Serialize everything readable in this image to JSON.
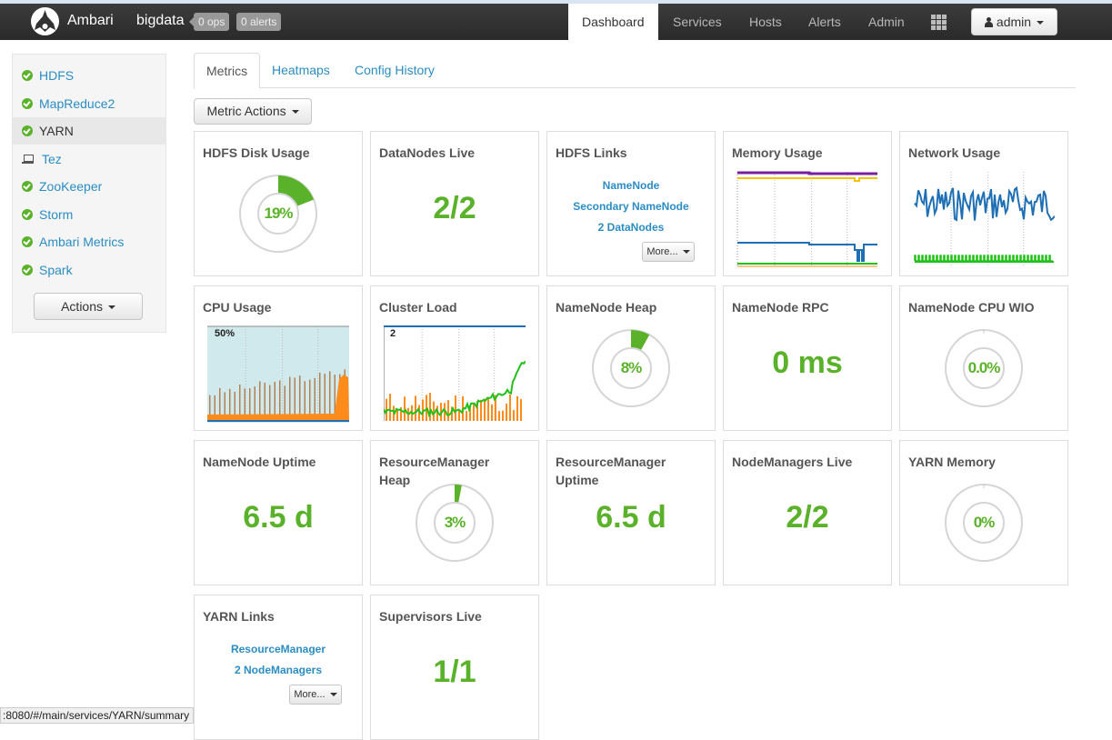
{
  "header": {
    "brand": "Ambari",
    "cluster_name": "bigdata",
    "ops_badge": "0 ops",
    "alerts_badge": "0 alerts",
    "nav": [
      {
        "label": "Dashboard",
        "active": true
      },
      {
        "label": "Services",
        "active": false
      },
      {
        "label": "Hosts",
        "active": false
      },
      {
        "label": "Alerts",
        "active": false
      },
      {
        "label": "Admin",
        "active": false
      }
    ],
    "views_icon": "grid-icon",
    "user_menu": "admin"
  },
  "sidebar": {
    "services": [
      {
        "label": "HDFS",
        "status": "ok"
      },
      {
        "label": "MapReduce2",
        "status": "ok"
      },
      {
        "label": "YARN",
        "status": "ok",
        "active": true
      },
      {
        "label": "Tez",
        "status": "client-only"
      },
      {
        "label": "ZooKeeper",
        "status": "ok"
      },
      {
        "label": "Storm",
        "status": "ok"
      },
      {
        "label": "Ambari Metrics",
        "status": "ok"
      },
      {
        "label": "Spark",
        "status": "ok"
      }
    ],
    "actions_label": "Actions"
  },
  "tabs": [
    {
      "label": "Metrics",
      "active": true
    },
    {
      "label": "Heatmaps",
      "active": false
    },
    {
      "label": "Config History",
      "active": false
    }
  ],
  "metric_actions_label": "Metric Actions",
  "colors": {
    "ok_green": "#5ab22a",
    "link_blue": "#2b8dc3",
    "chart_blue": "#1f6fb4",
    "chart_orange": "#ff8c1a",
    "chart_purple": "#7a1fa2",
    "chart_yellow": "#f5c400",
    "chart_green": "#22c01a",
    "cpu_bg": "#cfe9ec"
  },
  "widgets": {
    "hdfs_disk_usage": {
      "title": "HDFS Disk Usage",
      "value": "19%",
      "fraction": 0.19
    },
    "datanodes_live": {
      "title": "DataNodes Live",
      "value": "2/2"
    },
    "hdfs_links": {
      "title": "HDFS Links",
      "links": [
        "NameNode",
        "Secondary NameNode",
        "2 DataNodes"
      ],
      "more": "More..."
    },
    "memory_usage": {
      "title": "Memory Usage"
    },
    "network_usage": {
      "title": "Network Usage"
    },
    "cpu_usage": {
      "title": "CPU Usage",
      "axis_label": "50%"
    },
    "cluster_load": {
      "title": "Cluster Load",
      "axis_label": "2"
    },
    "namenode_heap": {
      "title": "NameNode Heap",
      "value": "8%",
      "fraction": 0.08
    },
    "namenode_rpc": {
      "title": "NameNode RPC",
      "value": "0 ms"
    },
    "namenode_cpu_wio": {
      "title": "NameNode CPU WIO",
      "value": "0.0%",
      "fraction": 0.0
    },
    "namenode_uptime": {
      "title": "NameNode Uptime",
      "value": "6.5 d"
    },
    "rm_heap": {
      "title": "ResourceManager Heap",
      "value": "3%",
      "fraction": 0.03
    },
    "rm_uptime": {
      "title": "ResourceManager Uptime",
      "value": "6.5 d"
    },
    "nodemanagers_live": {
      "title": "NodeManagers Live",
      "value": "2/2"
    },
    "yarn_memory": {
      "title": "YARN Memory",
      "value": "0%",
      "fraction": 0.0
    },
    "yarn_links": {
      "title": "YARN Links",
      "links": [
        "ResourceManager",
        "2 NodeManagers"
      ],
      "more": "More..."
    },
    "supervisors_live": {
      "title": "Supervisors Live",
      "value": "1/1"
    }
  },
  "status_bar": ":8080/#/main/services/YARN/summary"
}
